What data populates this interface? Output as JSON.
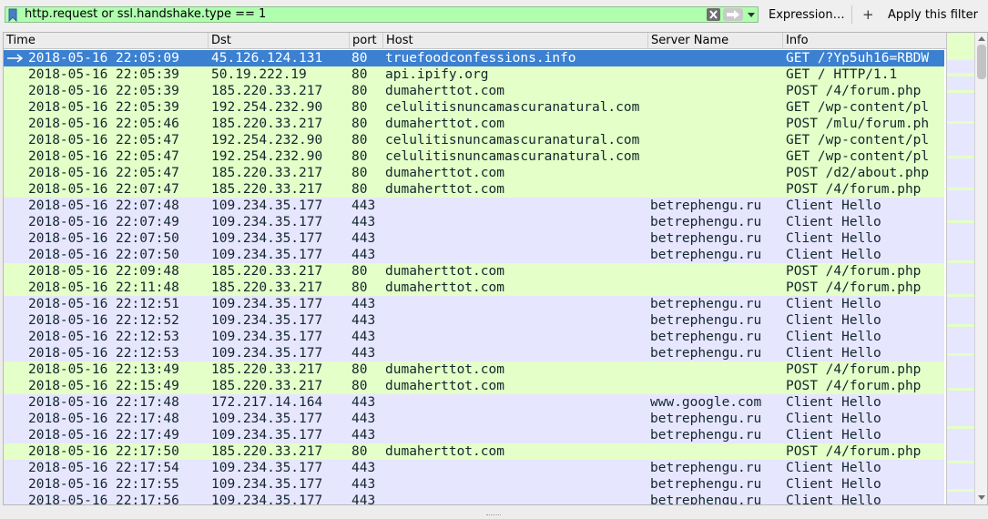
{
  "filter": {
    "value": "http.request or ssl.handshake.type == 1",
    "expression_label": "Expression…",
    "apply_label": "Apply this filter",
    "add_label": "+"
  },
  "colors": {
    "filter_valid": "#afffaf",
    "http_row": "#e4ffc7",
    "tls_row": "#e7e6ff",
    "selected_row": "#3b80d1"
  },
  "icons": {
    "bookmark": "bookmark-icon",
    "clear": "clear-icon",
    "apply": "arrow-right-icon",
    "history": "chevron-down-icon",
    "selected_marker": "arrow-right-icon"
  },
  "columns": [
    {
      "key": "time",
      "label": "Time"
    },
    {
      "key": "dst",
      "label": "Dst"
    },
    {
      "key": "port",
      "label": "port"
    },
    {
      "key": "host",
      "label": "Host"
    },
    {
      "key": "server",
      "label": "Server Name"
    },
    {
      "key": "info",
      "label": "Info"
    }
  ],
  "packets": [
    {
      "time": "2018-05-16 22:05:09",
      "dst": "45.126.124.131",
      "port": "80",
      "host": "truefoodconfessions.info",
      "server": "",
      "info": "GET /?Yp5uh16=RBDW",
      "kind": "http",
      "selected": true
    },
    {
      "time": "2018-05-16 22:05:39",
      "dst": "50.19.222.19",
      "port": "80",
      "host": "api.ipify.org",
      "server": "",
      "info": "GET / HTTP/1.1",
      "kind": "http"
    },
    {
      "time": "2018-05-16 22:05:39",
      "dst": "185.220.33.217",
      "port": "80",
      "host": "dumaherttot.com",
      "server": "",
      "info": "POST /4/forum.php",
      "kind": "http"
    },
    {
      "time": "2018-05-16 22:05:39",
      "dst": "192.254.232.90",
      "port": "80",
      "host": "celulitisnuncamascuranatural.com",
      "server": "",
      "info": "GET /wp-content/pl",
      "kind": "http"
    },
    {
      "time": "2018-05-16 22:05:46",
      "dst": "185.220.33.217",
      "port": "80",
      "host": "dumaherttot.com",
      "server": "",
      "info": "POST /mlu/forum.ph",
      "kind": "http"
    },
    {
      "time": "2018-05-16 22:05:47",
      "dst": "192.254.232.90",
      "port": "80",
      "host": "celulitisnuncamascuranatural.com",
      "server": "",
      "info": "GET /wp-content/pl",
      "kind": "http"
    },
    {
      "time": "2018-05-16 22:05:47",
      "dst": "192.254.232.90",
      "port": "80",
      "host": "celulitisnuncamascuranatural.com",
      "server": "",
      "info": "GET /wp-content/pl",
      "kind": "http"
    },
    {
      "time": "2018-05-16 22:05:47",
      "dst": "185.220.33.217",
      "port": "80",
      "host": "dumaherttot.com",
      "server": "",
      "info": "POST /d2/about.php",
      "kind": "http"
    },
    {
      "time": "2018-05-16 22:07:47",
      "dst": "185.220.33.217",
      "port": "80",
      "host": "dumaherttot.com",
      "server": "",
      "info": "POST /4/forum.php",
      "kind": "http"
    },
    {
      "time": "2018-05-16 22:07:48",
      "dst": "109.234.35.177",
      "port": "443",
      "host": "",
      "server": "betrephengu.ru",
      "info": "Client Hello",
      "kind": "tls"
    },
    {
      "time": "2018-05-16 22:07:49",
      "dst": "109.234.35.177",
      "port": "443",
      "host": "",
      "server": "betrephengu.ru",
      "info": "Client Hello",
      "kind": "tls"
    },
    {
      "time": "2018-05-16 22:07:50",
      "dst": "109.234.35.177",
      "port": "443",
      "host": "",
      "server": "betrephengu.ru",
      "info": "Client Hello",
      "kind": "tls"
    },
    {
      "time": "2018-05-16 22:07:50",
      "dst": "109.234.35.177",
      "port": "443",
      "host": "",
      "server": "betrephengu.ru",
      "info": "Client Hello",
      "kind": "tls"
    },
    {
      "time": "2018-05-16 22:09:48",
      "dst": "185.220.33.217",
      "port": "80",
      "host": "dumaherttot.com",
      "server": "",
      "info": "POST /4/forum.php",
      "kind": "http"
    },
    {
      "time": "2018-05-16 22:11:48",
      "dst": "185.220.33.217",
      "port": "80",
      "host": "dumaherttot.com",
      "server": "",
      "info": "POST /4/forum.php",
      "kind": "http"
    },
    {
      "time": "2018-05-16 22:12:51",
      "dst": "109.234.35.177",
      "port": "443",
      "host": "",
      "server": "betrephengu.ru",
      "info": "Client Hello",
      "kind": "tls"
    },
    {
      "time": "2018-05-16 22:12:52",
      "dst": "109.234.35.177",
      "port": "443",
      "host": "",
      "server": "betrephengu.ru",
      "info": "Client Hello",
      "kind": "tls"
    },
    {
      "time": "2018-05-16 22:12:53",
      "dst": "109.234.35.177",
      "port": "443",
      "host": "",
      "server": "betrephengu.ru",
      "info": "Client Hello",
      "kind": "tls"
    },
    {
      "time": "2018-05-16 22:12:53",
      "dst": "109.234.35.177",
      "port": "443",
      "host": "",
      "server": "betrephengu.ru",
      "info": "Client Hello",
      "kind": "tls"
    },
    {
      "time": "2018-05-16 22:13:49",
      "dst": "185.220.33.217",
      "port": "80",
      "host": "dumaherttot.com",
      "server": "",
      "info": "POST /4/forum.php",
      "kind": "http"
    },
    {
      "time": "2018-05-16 22:15:49",
      "dst": "185.220.33.217",
      "port": "80",
      "host": "dumaherttot.com",
      "server": "",
      "info": "POST /4/forum.php",
      "kind": "http"
    },
    {
      "time": "2018-05-16 22:17:48",
      "dst": "172.217.14.164",
      "port": "443",
      "host": "",
      "server": "www.google.com",
      "info": "Client Hello",
      "kind": "tls"
    },
    {
      "time": "2018-05-16 22:17:48",
      "dst": "109.234.35.177",
      "port": "443",
      "host": "",
      "server": "betrephengu.ru",
      "info": "Client Hello",
      "kind": "tls"
    },
    {
      "time": "2018-05-16 22:17:49",
      "dst": "109.234.35.177",
      "port": "443",
      "host": "",
      "server": "betrephengu.ru",
      "info": "Client Hello",
      "kind": "tls"
    },
    {
      "time": "2018-05-16 22:17:50",
      "dst": "185.220.33.217",
      "port": "80",
      "host": "dumaherttot.com",
      "server": "",
      "info": "POST /4/forum.php",
      "kind": "http"
    },
    {
      "time": "2018-05-16 22:17:54",
      "dst": "109.234.35.177",
      "port": "443",
      "host": "",
      "server": "betrephengu.ru",
      "info": "Client Hello",
      "kind": "tls"
    },
    {
      "time": "2018-05-16 22:17:55",
      "dst": "109.234.35.177",
      "port": "443",
      "host": "",
      "server": "betrephengu.ru",
      "info": "Client Hello",
      "kind": "tls"
    },
    {
      "time": "2018-05-16 22:17:56",
      "dst": "109.234.35.177",
      "port": "443",
      "host": "",
      "server": "betrephengu.ru",
      "info": "Client Hello",
      "kind": "tls"
    }
  ]
}
